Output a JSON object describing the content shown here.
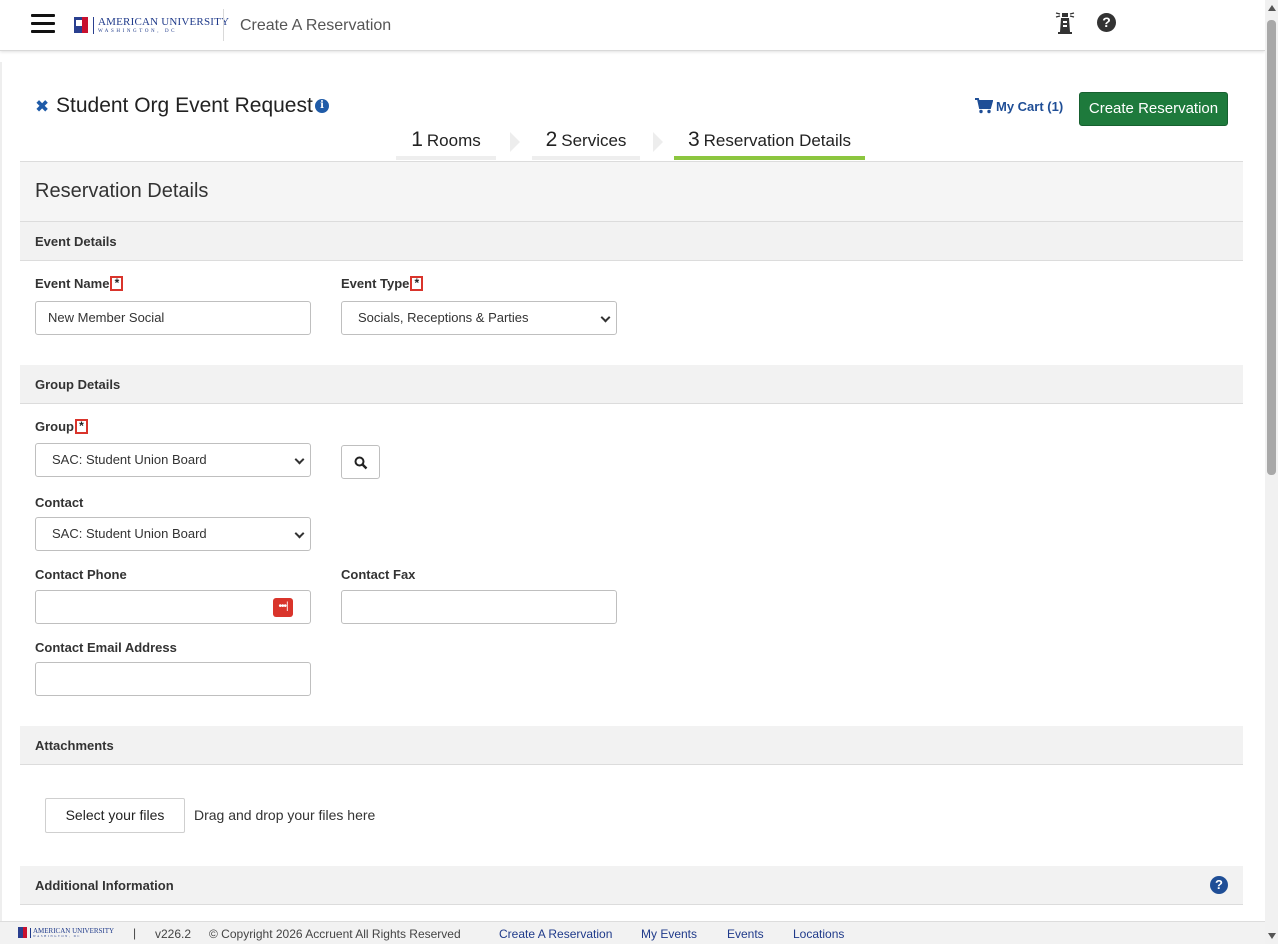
{
  "header": {
    "app_title": "Create A Reservation",
    "logo": {
      "line1": "AMERICAN UNIVERSITY",
      "line2": "WASHINGTON, DC"
    },
    "icons": [
      "hamburger-menu-icon",
      "lighthouse-icon",
      "help-icon"
    ]
  },
  "page": {
    "title": "Student Org Event Request",
    "cart_label": "My Cart (1)",
    "create_button": "Create Reservation",
    "steps": [
      {
        "num": "1",
        "label": "Rooms",
        "active": false
      },
      {
        "num": "2",
        "label": "Services",
        "active": false
      },
      {
        "num": "3",
        "label": "Reservation Details",
        "active": true
      }
    ]
  },
  "form": {
    "heading": "Reservation Details",
    "event_details": {
      "section_title": "Event Details",
      "event_name_label": "Event Name",
      "event_name_value": "New Member Social",
      "event_type_label": "Event Type",
      "event_type_value": "Socials, Receptions & Parties",
      "required_marker": "*"
    },
    "group_details": {
      "section_title": "Group Details",
      "group_label": "Group",
      "group_value": "SAC: Student Union Board",
      "contact_label": "Contact",
      "contact_value": "SAC: Student Union Board",
      "phone_label": "Contact Phone",
      "phone_value": "",
      "phone_badge": "•••|",
      "fax_label": "Contact Fax",
      "fax_value": "",
      "email_label": "Contact Email Address",
      "email_value": ""
    },
    "attachments": {
      "section_title": "Attachments",
      "select_files": "Select your files",
      "drag_text": "Drag and drop your files here"
    },
    "additional": {
      "section_title": "Additional Information"
    }
  },
  "footer": {
    "separator": "|",
    "version": "v226.2",
    "copyright": "© Copyright 2026 Accruent All Rights Reserved",
    "links": [
      "Create A Reservation",
      "My Events",
      "Events",
      "Locations"
    ]
  },
  "colors": {
    "primary_button": "#1e7a3c",
    "link_blue": "#1f4e96",
    "active_step": "#8cc63f",
    "required_border": "#d9342b"
  }
}
